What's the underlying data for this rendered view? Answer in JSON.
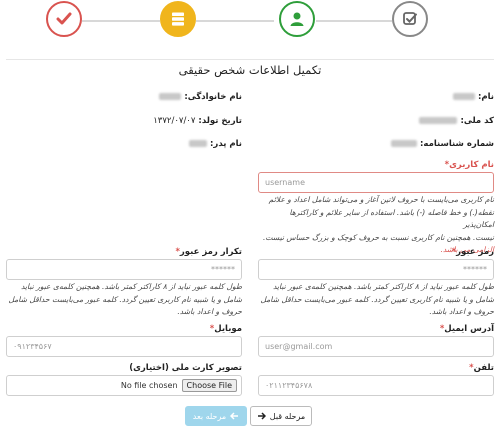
{
  "colors": {
    "red": "#d9534f",
    "yellow": "#f0b51c",
    "green": "#2e9e3a",
    "gray": "#888888",
    "next_button": "#9fd6ec"
  },
  "steps": [
    {
      "icon": "checkmark-icon",
      "state": "done"
    },
    {
      "icon": "server-stack-icon",
      "state": "active"
    },
    {
      "icon": "user-icon",
      "state": "current"
    },
    {
      "icon": "checkbox-icon",
      "state": "pending"
    }
  ],
  "form": {
    "title": "تکمیل اطلاعات شخص حقیقی",
    "first_name_label": "نام:",
    "last_name_label": "نام خانوادگی:",
    "national_code_label": "کد ملی:",
    "birth_date_label": "تاریخ تولد:",
    "birth_date_value": "۱۳۷۲/۰۷/۰۷",
    "id_number_label": "شماره شناسنامه:",
    "father_name_label": "نام پدر:",
    "username_label": "نام کاربری",
    "username_placeholder": "username",
    "username_hint_1": "نام کاربری می‌بایست با حروف لاتین آغاز و می‌تواند شامل اعداد و علائم",
    "username_hint_2": "نقطه(.) و خط فاصله (-) باشد. استفاده از سایر علائم و کاراکترها امکان‌پذیر",
    "username_hint_3": "نیست. همچنین نام کاربری نسبت به حروف کوچک و بزرگ حساس نیست.",
    "username_hint_required": "الزامی می باشد.",
    "password_label": "رمز عبور",
    "password_placeholder": "******",
    "password_confirm_label": "تکرار رمز عبور",
    "password_confirm_placeholder": "******",
    "password_hint_1": "طول کلمه عبور نباید از ۸ کاراکتر کمتر باشد. همچنین کلمه‌ی عبور نباید",
    "password_hint_2": "شامل و یا شبیه نام کاربری تعیین گردد. کلمه عبور می‌بایست حداقل شامل",
    "password_hint_3": "حروف و اعداد باشد.",
    "password_confirm_hint_1": "طول کلمه عبور نباید از ۸ کاراکتر کمتر باشد. همچنین کلمه‌ی عبور نباید",
    "password_confirm_hint_2": "شامل و یا شبیه نام کاربری تعیین گردد. کلمه عبور می‌بایست حداقل شامل",
    "password_confirm_hint_3": "حروف و اعداد باشد.",
    "email_label": "آدرس ایمیل",
    "email_placeholder": "user@gmail.com",
    "mobile_label": "موبایل",
    "mobile_placeholder": "۰۹۱۲۳۴۵۶۷",
    "phone_label": "تلفن",
    "phone_placeholder": "۰۲۱۱۲۳۴۵۶۷۸",
    "national_card_label": "تصویر کارت ملی (اختیاری)",
    "file_status": "No file chosen",
    "file_button": "Choose File",
    "required_mark": "*"
  },
  "buttons": {
    "next_label": "مرحله بعد",
    "prev_label": "مرحله قبل"
  }
}
